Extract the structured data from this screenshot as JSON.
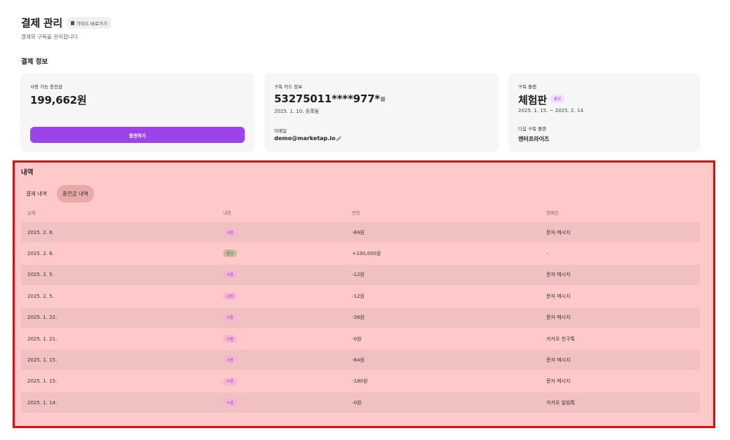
{
  "header": {
    "title": "결제 관리",
    "guide_button": "가이드 바로가기",
    "subtitle": "결제와 구독을 관리합니다."
  },
  "payment_info": {
    "section_title": "결제 정보",
    "balance_card": {
      "label": "사용 가능 충전금",
      "amount": "199,662원",
      "charge_button": "충전하기"
    },
    "card_info": {
      "label": "구독 카드 정보",
      "card_number": "53275011****977*",
      "registered": "2025. 1. 10. 등록됨",
      "email_label": "이메일",
      "email": "demo@marketap.io"
    },
    "plan": {
      "label": "구독 플랜",
      "name": "체험판",
      "status": "활성",
      "period": "2025. 1. 15. ~ 2025. 2. 14.",
      "next_label": "다음 구독 플랜",
      "next_plan": "엔터프라이즈"
    }
  },
  "history": {
    "title": "내역",
    "tabs": [
      "결제 내역",
      "충전금 내역"
    ],
    "active_tab": "충전금 내역",
    "columns": [
      "날짜",
      "내용",
      "변동",
      "캠페인"
    ],
    "rows": [
      {
        "date": "2025. 2. 6.",
        "type": "사용",
        "change": "-84원",
        "campaign": "문자 메시지"
      },
      {
        "date": "2025. 2. 6.",
        "type": "충전",
        "change": "+100,000원",
        "campaign": "-"
      },
      {
        "date": "2025. 2. 5.",
        "type": "사용",
        "change": "-12원",
        "campaign": "문자 메시지"
      },
      {
        "date": "2025. 2. 5.",
        "type": "사용",
        "change": "-12원",
        "campaign": "문자 메시지"
      },
      {
        "date": "2025. 1. 22.",
        "type": "사용",
        "change": "-36원",
        "campaign": "문자 메시지"
      },
      {
        "date": "2025. 1. 21.",
        "type": "사용",
        "change": "-0원",
        "campaign": "카카오 친구톡"
      },
      {
        "date": "2025. 1. 15.",
        "type": "사용",
        "change": "-84원",
        "campaign": "문자 메시지"
      },
      {
        "date": "2025. 1. 15.",
        "type": "사용",
        "change": "-180원",
        "campaign": "문자 메시지"
      },
      {
        "date": "2025. 1. 14.",
        "type": "사용",
        "change": "-0원",
        "campaign": "카카오 알림톡"
      }
    ]
  },
  "colors": {
    "accent": "#9b44e9",
    "highlight_border": "#e00d0d",
    "highlight_fill": "#ffc9c9"
  }
}
